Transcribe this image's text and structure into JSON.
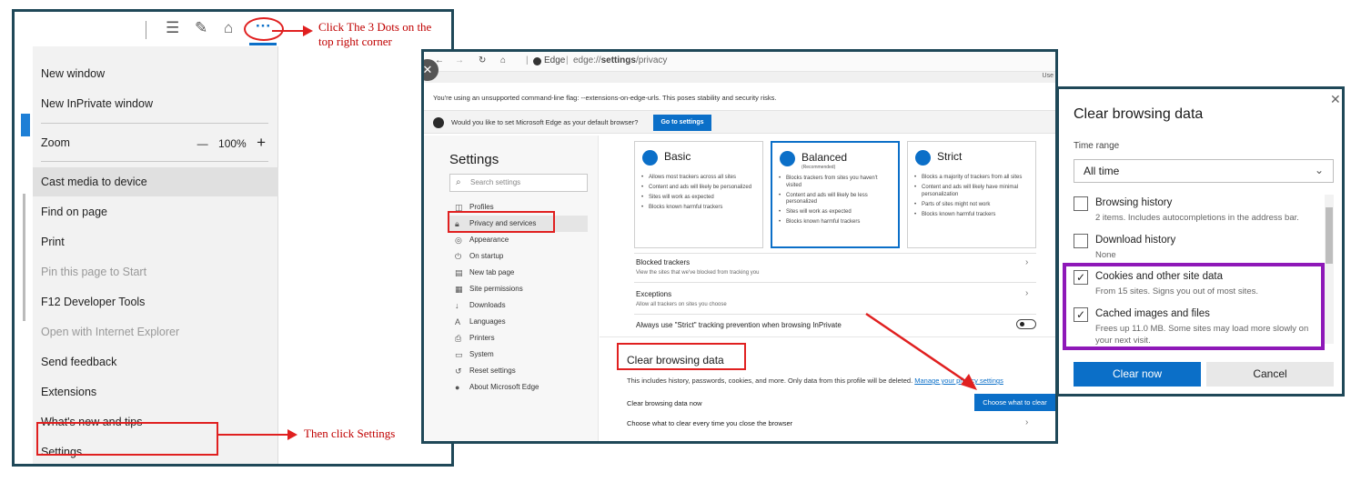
{
  "annotations": {
    "click_dots": "Click The 3 Dots on the top right corner",
    "click_dots_line1": "Click The 3 Dots on the",
    "click_dots_line2": "top right corner",
    "click_settings": "Then click Settings",
    "accent_color": "#e02020"
  },
  "panel1": {
    "menu": {
      "new_window": "New window",
      "new_inprivate": "New InPrivate window",
      "zoom_label": "Zoom",
      "zoom_minus": "—",
      "zoom_value": "100%",
      "zoom_plus": "+",
      "cast": "Cast media to device",
      "find": "Find on page",
      "print": "Print",
      "pin": "Pin this page to Start",
      "f12": "F12 Developer Tools",
      "open_ie": "Open with Internet Explorer",
      "feedback": "Send feedback",
      "extensions": "Extensions",
      "whats_new": "What's new and tips",
      "settings": "Settings"
    },
    "toolbar_icons": [
      "reading-list-icon",
      "web-note-icon",
      "share-icon",
      "more-icon"
    ]
  },
  "panel2": {
    "address": {
      "brand": "Edge",
      "url_prefix": "edge://",
      "url_path": "settings",
      "url_suffix": "/privacy",
      "tab_fragment": "Use"
    },
    "warning": "You're using an unsupported command-line flag: --extensions-on-edge-urls. This poses stability and security risks.",
    "default_prompt": "Would you like to set Microsoft Edge as your default browser?",
    "go_to_settings": "Go to settings",
    "nav": {
      "title": "Settings",
      "search_placeholder": "Search settings",
      "items": [
        "Profiles",
        "Privacy and services",
        "Appearance",
        "On startup",
        "New tab page",
        "Site permissions",
        "Downloads",
        "Languages",
        "Printers",
        "System",
        "Reset settings",
        "About Microsoft Edge"
      ]
    },
    "cards": [
      {
        "title": "Basic",
        "subtitle": "",
        "bullets": [
          "Allows most trackers across all sites",
          "Content and ads will likely be personalized",
          "Sites will work as expected",
          "Blocks known harmful trackers"
        ]
      },
      {
        "title": "Balanced",
        "subtitle": "(Recommended)",
        "bullets": [
          "Blocks trackers from sites you haven't visited",
          "Content and ads will likely be less personalized",
          "Sites will work as expected",
          "Blocks known harmful trackers"
        ]
      },
      {
        "title": "Strict",
        "subtitle": "",
        "bullets": [
          "Blocks a majority of trackers from all sites",
          "Content and ads will likely have minimal personalization",
          "Parts of sites might not work",
          "Blocks known harmful trackers"
        ]
      }
    ],
    "blocked_trackers": "Blocked trackers",
    "blocked_desc": "View the sites that we've blocked from tracking you",
    "exceptions": "Exceptions",
    "exceptions_desc": "Allow all trackers on sites you choose",
    "always_strict": "Always use \"Strict\" tracking prevention when browsing InPrivate",
    "clear_heading": "Clear browsing data",
    "clear_desc": "This includes history, passwords, cookies, and more. Only data from this profile will be deleted.",
    "manage_link": "Manage your privacy settings",
    "clear_now": "Clear browsing data now",
    "choose_btn": "Choose what to clear",
    "choose_every": "Choose what to clear every time you close the browser"
  },
  "panel3": {
    "title": "Clear browsing data",
    "time_range_label": "Time range",
    "time_range_value": "All time",
    "options": [
      {
        "title": "Browsing history",
        "desc": "2 items. Includes autocompletions in the address bar.",
        "checked": false
      },
      {
        "title": "Download history",
        "desc": "None",
        "checked": false
      },
      {
        "title": "Cookies and other site data",
        "desc": "From 15 sites. Signs you out of most sites.",
        "checked": true
      },
      {
        "title": "Cached images and files",
        "desc": "Frees up 11.0 MB. Some sites may load more slowly on your next visit.",
        "checked": true
      }
    ],
    "check_mark": "✓",
    "clear_now": "Clear now",
    "cancel": "Cancel",
    "highlight_color": "#8e18b8"
  }
}
